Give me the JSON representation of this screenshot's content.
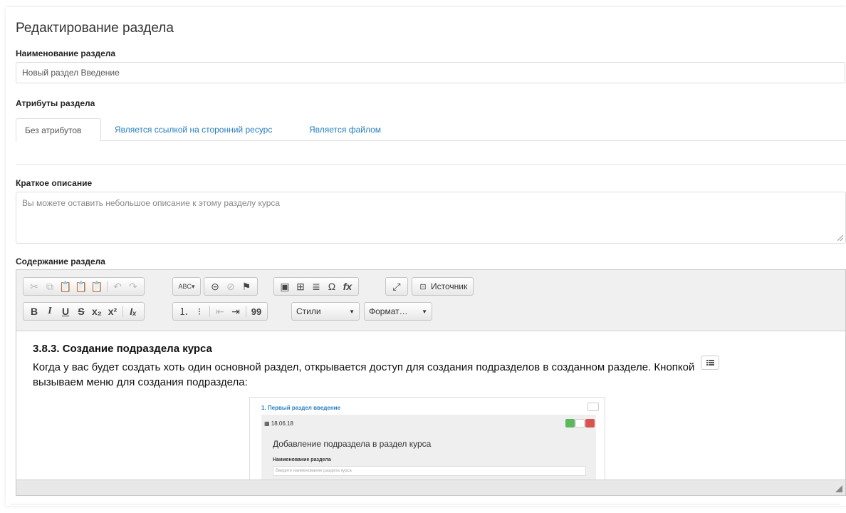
{
  "form": {
    "title": "Редактирование раздела",
    "name_label": "Наименование раздела",
    "name_value": "Новый раздел Введение",
    "attributes_label": "Атрибуты раздела",
    "tabs": [
      {
        "label": "Без атрибутов",
        "active": true
      },
      {
        "label": "Является ссылкой на сторонний ресурс",
        "active": false
      },
      {
        "label": "Является файлом",
        "active": false
      }
    ],
    "short_desc_label": "Краткое описание",
    "short_desc_placeholder": "Вы можете оставить небольшое описание к этому разделу курса",
    "content_label": "Содержание раздела"
  },
  "toolbar": {
    "source_label": "Источник",
    "styles_label": "Стили",
    "format_label": "Формат…",
    "spell_label": "ABC",
    "bold": "B",
    "italic": "I",
    "underline": "U",
    "strike": "S",
    "quote": "99",
    "special_char": "Ω",
    "formula": "fx"
  },
  "editor_content": {
    "heading": "3.8.3. Создание подраздела курса",
    "paragraph_part1": "Когда у вас будет создать хоть один основной раздел, открывается доступ для создания подразделов в созданном разделе. Кнопкой",
    "paragraph_part2": "вызываем меню для создания подраздела:",
    "embedded": {
      "section_title": "1. Первый раздел введение",
      "date": "18.06.18",
      "dialog_title": "Добавление подраздела в раздел курса",
      "field_label": "Наименование раздела",
      "field_placeholder": "Введите наименование раздела курса"
    }
  },
  "colors": {
    "link": "#2a7fc1",
    "green_button": "#5cb85c",
    "red_button": "#d9534f"
  }
}
